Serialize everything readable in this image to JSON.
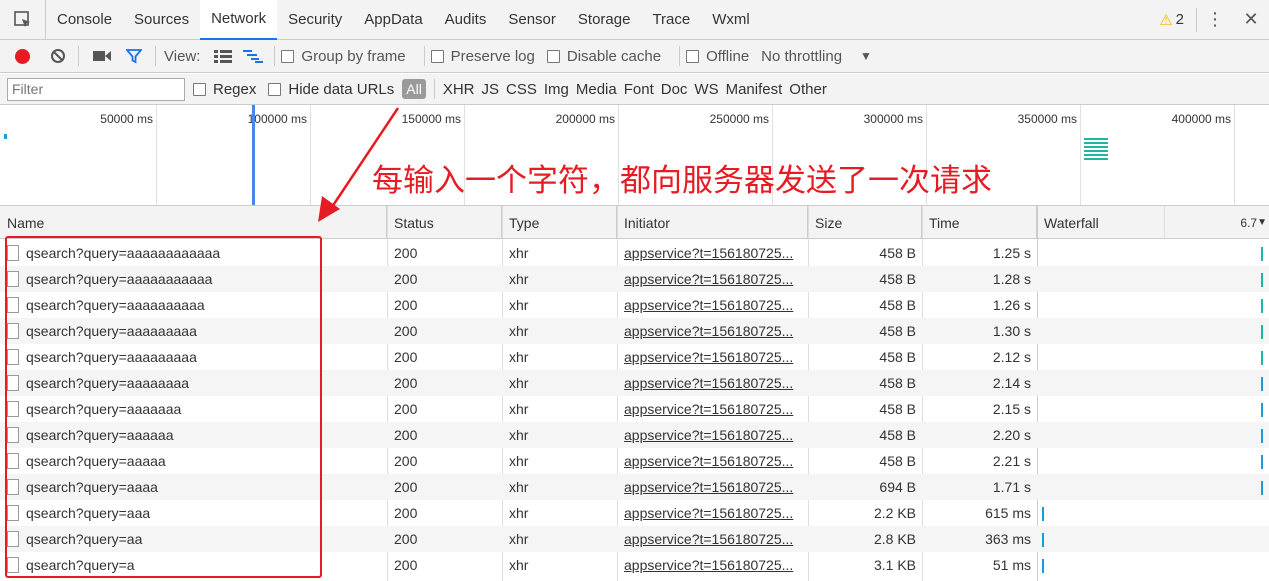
{
  "tabs": [
    {
      "label": "Console",
      "active": false
    },
    {
      "label": "Sources",
      "active": false
    },
    {
      "label": "Network",
      "active": true
    },
    {
      "label": "Security",
      "active": false
    },
    {
      "label": "AppData",
      "active": false
    },
    {
      "label": "Audits",
      "active": false
    },
    {
      "label": "Sensor",
      "active": false
    },
    {
      "label": "Storage",
      "active": false
    },
    {
      "label": "Trace",
      "active": false
    },
    {
      "label": "Wxml",
      "active": false
    }
  ],
  "warnings": {
    "count": "2"
  },
  "toolbar": {
    "view_label": "View:",
    "group_by_frame": "Group by frame",
    "preserve_log": "Preserve log",
    "disable_cache": "Disable cache",
    "offline": "Offline",
    "throttling": "No throttling"
  },
  "filterbar": {
    "placeholder": "Filter",
    "regex": "Regex",
    "hide_data_urls": "Hide data URLs",
    "types": [
      "All",
      "XHR",
      "JS",
      "CSS",
      "Img",
      "Media",
      "Font",
      "Doc",
      "WS",
      "Manifest",
      "Other"
    ]
  },
  "overview": {
    "ticks": [
      "50000 ms",
      "100000 ms",
      "150000 ms",
      "200000 ms",
      "250000 ms",
      "300000 ms",
      "350000 ms",
      "400000 ms"
    ]
  },
  "annotation": "每输入一个字符，都向服务器发送了一次请求",
  "columns": {
    "name": "Name",
    "status": "Status",
    "type": "Type",
    "initiator": "Initiator",
    "size": "Size",
    "time": "Time",
    "waterfall": "Waterfall",
    "waterfall_scale": "6.7"
  },
  "requests": [
    {
      "name": "qsearch?query=aaaaaaaaaaaa",
      "status": "200",
      "type": "xhr",
      "initiator": "appservice?t=156180725...",
      "size": "458 B",
      "time": "1.25 s"
    },
    {
      "name": "qsearch?query=aaaaaaaaaaa",
      "status": "200",
      "type": "xhr",
      "initiator": "appservice?t=156180725...",
      "size": "458 B",
      "time": "1.28 s"
    },
    {
      "name": "qsearch?query=aaaaaaaaaa",
      "status": "200",
      "type": "xhr",
      "initiator": "appservice?t=156180725...",
      "size": "458 B",
      "time": "1.26 s"
    },
    {
      "name": "qsearch?query=aaaaaaaaa",
      "status": "200",
      "type": "xhr",
      "initiator": "appservice?t=156180725...",
      "size": "458 B",
      "time": "1.30 s"
    },
    {
      "name": "qsearch?query=aaaaaaaaa",
      "status": "200",
      "type": "xhr",
      "initiator": "appservice?t=156180725...",
      "size": "458 B",
      "time": "2.12 s"
    },
    {
      "name": "qsearch?query=aaaaaaaa",
      "status": "200",
      "type": "xhr",
      "initiator": "appservice?t=156180725...",
      "size": "458 B",
      "time": "2.14 s"
    },
    {
      "name": "qsearch?query=aaaaaaa",
      "status": "200",
      "type": "xhr",
      "initiator": "appservice?t=156180725...",
      "size": "458 B",
      "time": "2.15 s"
    },
    {
      "name": "qsearch?query=aaaaaa",
      "status": "200",
      "type": "xhr",
      "initiator": "appservice?t=156180725...",
      "size": "458 B",
      "time": "2.20 s"
    },
    {
      "name": "qsearch?query=aaaaa",
      "status": "200",
      "type": "xhr",
      "initiator": "appservice?t=156180725...",
      "size": "458 B",
      "time": "2.21 s"
    },
    {
      "name": "qsearch?query=aaaa",
      "status": "200",
      "type": "xhr",
      "initiator": "appservice?t=156180725...",
      "size": "694 B",
      "time": "1.71 s"
    },
    {
      "name": "qsearch?query=aaa",
      "status": "200",
      "type": "xhr",
      "initiator": "appservice?t=156180725...",
      "size": "2.2 KB",
      "time": "615 ms"
    },
    {
      "name": "qsearch?query=aa",
      "status": "200",
      "type": "xhr",
      "initiator": "appservice?t=156180725...",
      "size": "2.8 KB",
      "time": "363 ms"
    },
    {
      "name": "qsearch?query=a",
      "status": "200",
      "type": "xhr",
      "initiator": "appservice?t=156180725...",
      "size": "3.1 KB",
      "time": "51 ms"
    }
  ],
  "colors": {
    "accent": "#1a73e8",
    "record": "#e51c23",
    "annotation": "#e51c23",
    "wf_teal": "#1fb5a0",
    "wf_blue": "#1b9bd7"
  }
}
